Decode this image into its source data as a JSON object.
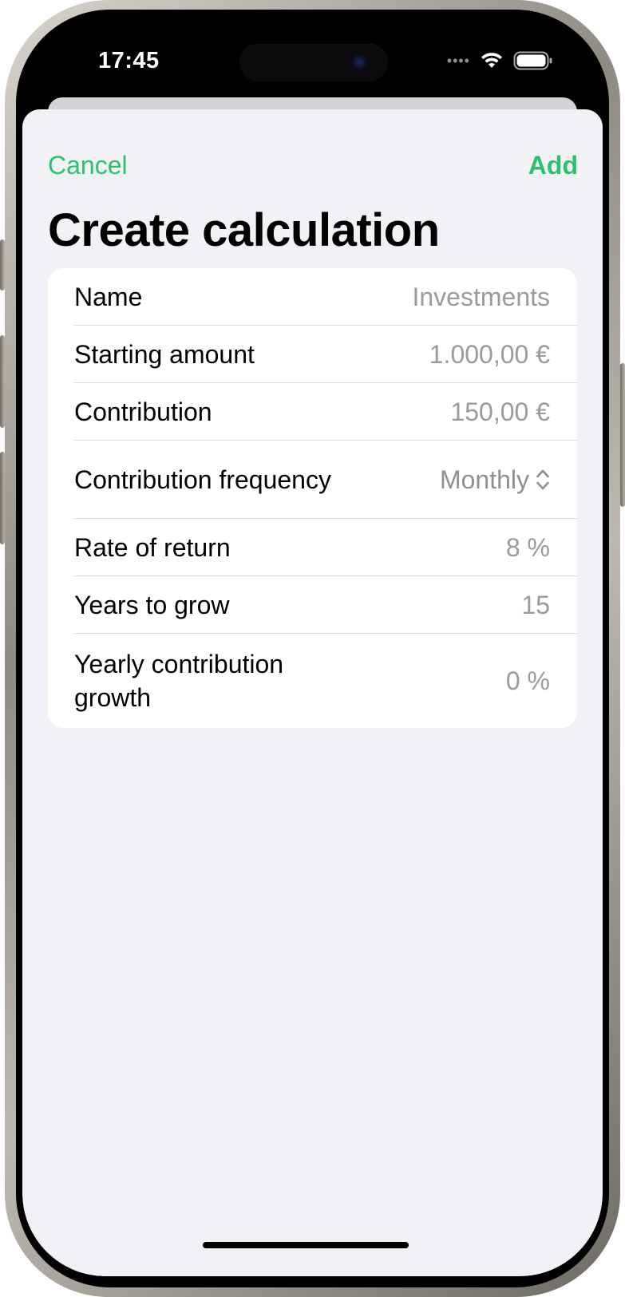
{
  "status_bar": {
    "time": "17:45",
    "signal_icon": "cellular-dots-icon",
    "wifi_icon": "wifi-icon",
    "battery_icon": "battery-icon"
  },
  "navigation": {
    "cancel_label": "Cancel",
    "add_label": "Add",
    "accent_color": "#2ac36c"
  },
  "page": {
    "title": "Create calculation"
  },
  "form": {
    "name": {
      "label": "Name",
      "placeholder": "Investments",
      "value": ""
    },
    "starting_amount": {
      "label": "Starting amount",
      "placeholder": "1.000,00 €",
      "value": ""
    },
    "contribution": {
      "label": "Contribution",
      "placeholder": "150,00 €",
      "value": ""
    },
    "contribution_frequency": {
      "label": "Contribution frequency",
      "value": "Monthly",
      "icon": "chevron-up-down-icon"
    },
    "rate_of_return": {
      "label": "Rate of return",
      "placeholder": "8 %",
      "value": ""
    },
    "years_to_grow": {
      "label": "Years to grow",
      "placeholder": "15",
      "value": ""
    },
    "yearly_contribution_growth": {
      "label": "Yearly contribution growth",
      "placeholder": "0 %",
      "value": ""
    }
  }
}
